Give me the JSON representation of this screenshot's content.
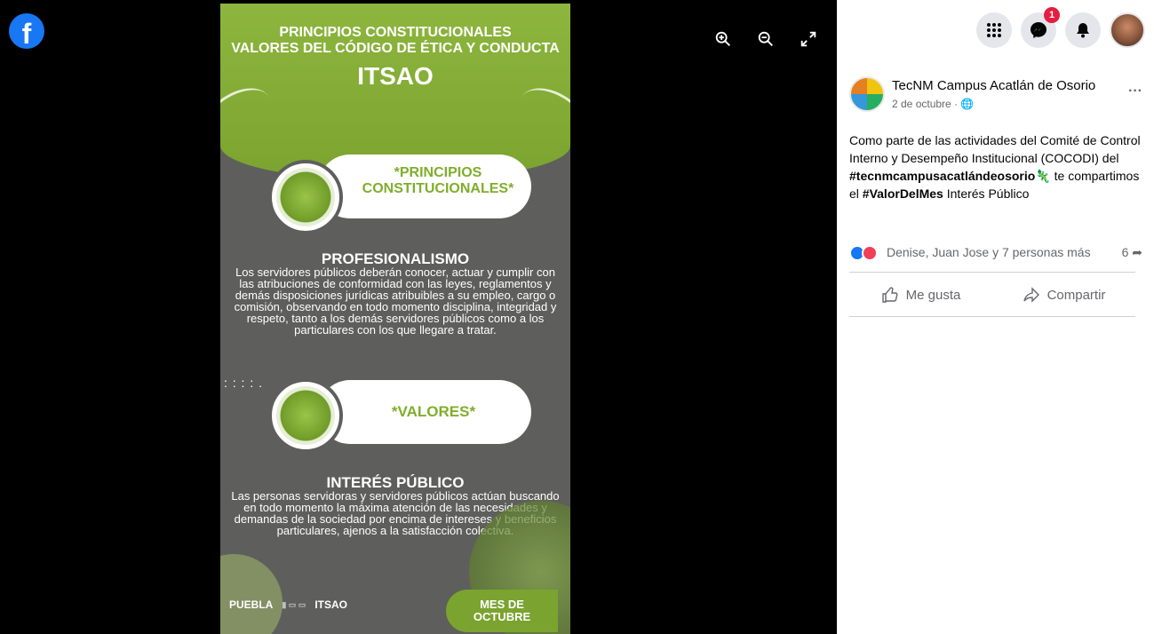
{
  "viewer": {
    "logo_letter": "f",
    "tools": [
      {
        "icon": "zoom-in-icon"
      },
      {
        "icon": "zoom-out-icon"
      },
      {
        "icon": "fullscreen-icon"
      }
    ]
  },
  "poster": {
    "title_line1": "PRINCIPIOS CONSTITUCIONALES",
    "title_line2": "VALORES DEL CÓDIGO DE ÉTICA Y CONDUCTA",
    "title_itsao": "ITSAO",
    "pill1": "*PRINCIPIOS CONSTITUCIONALES*",
    "section1_heading": "PROFESIONALISMO",
    "section1_body": "Los servidores públicos deberán conocer, actuar y cumplir con las atribuciones de conformidad con las leyes, reglamentos y demás disposiciones jurídicas atribuibles a su empleo, cargo o comisión, observando en todo momento disciplina, integridad y respeto, tanto a los demás servidores públicos como a los particulares con los que llegare a tratar.",
    "dots": ". . . .\n. . . . .",
    "pill2": "*VALORES*",
    "section2_heading": "INTERÉS PÚBLICO",
    "section2_body": "Las personas servidoras y servidores públicos actúan buscando en todo momento la máxima atención de las necesidades y demandas de la sociedad por encima de intereses y beneficios particulares, ajenos a la satisfacción colectiva.",
    "footer_logos": [
      "PUEBLA",
      "ITSAO"
    ],
    "mes_line1": "MES DE",
    "mes_line2": "OCTUBRE"
  },
  "topbar": {
    "messenger_badge": "1"
  },
  "post": {
    "page_name": "TecNM Campus Acatlán de Osorio",
    "date": "2 de octubre · ",
    "more": "···",
    "text_part1": "Como parte de las actividades del Comité de Control Interno y Desempeño Institucional (COCODI) del ",
    "hashtag1": "#tecnmcampusacatlándeosorio",
    "text_part2": " te compartimos el ",
    "hashtag2": "#ValorDelMes",
    "text_part3": " Interés Público",
    "reactions_names": "Denise, Juan Jose y 7 personas más",
    "share_count": "6",
    "like_label": "Me gusta",
    "share_label": "Compartir"
  },
  "colors": {
    "poster_green": "#7ba32f",
    "facebook_blue": "#1877f2",
    "badge_red": "#e41e3f"
  }
}
